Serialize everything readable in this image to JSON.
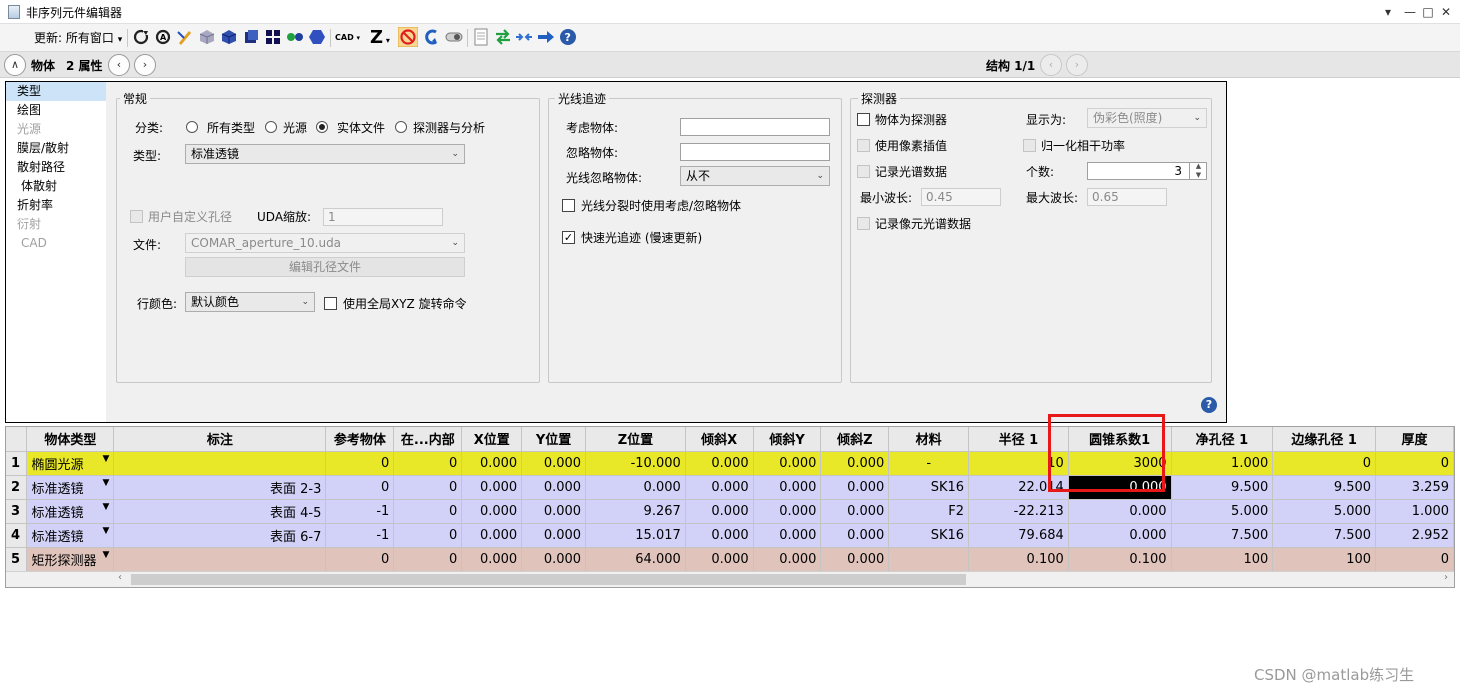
{
  "window": {
    "title": "非序列元件编辑器",
    "controls": [
      "▾",
      "—",
      "□",
      "✕"
    ]
  },
  "toolbar": {
    "update_label": "更新:",
    "update_value": "所有窗口",
    "buttons": [
      "reload-icon",
      "reload-all-icon",
      "pen-icon",
      "cube-gray-icon",
      "cube-blue-icon",
      "cube-navy-icon",
      "grid-icon",
      "dots-icon",
      "hexagon-icon",
      "cad-icon",
      "z-icon",
      "no-icon",
      "undo-icon",
      "toggle-icon",
      "page-icon",
      "swap-icon",
      "collapse-icon",
      "arrow-right-icon",
      "help-icon"
    ],
    "cad_label": "CAD",
    "z_label": "Z"
  },
  "nav": {
    "object_label": "物体",
    "property_label": "2 属性",
    "structure_label": "结构 1/1"
  },
  "sidebar": {
    "items": [
      {
        "label": "类型",
        "selected": true,
        "disabled": false
      },
      {
        "label": "绘图",
        "selected": false,
        "disabled": false
      },
      {
        "label": "光源",
        "selected": false,
        "disabled": true
      },
      {
        "label": "膜层/散射",
        "selected": false,
        "disabled": false
      },
      {
        "label": "散射路径",
        "selected": false,
        "disabled": false
      },
      {
        "label": "体散射",
        "selected": false,
        "disabled": false
      },
      {
        "label": "折射率",
        "selected": false,
        "disabled": false
      },
      {
        "label": "衍射",
        "selected": false,
        "disabled": true
      },
      {
        "label": "CAD",
        "selected": false,
        "disabled": true
      }
    ]
  },
  "general": {
    "title": "常规",
    "category_label": "分类:",
    "radios": [
      "所有类型",
      "光源",
      "实体文件",
      "探测器与分析"
    ],
    "selected_radio": 2,
    "type_label": "类型:",
    "type_value": "标准透镜",
    "user_aperture_label": "用户自定义孔径",
    "uda_scale_label": "UDA缩放:",
    "uda_scale_value": "1",
    "file_label": "文件:",
    "file_value": "COMAR_aperture_10.uda",
    "edit_aperture_button": "编辑孔径文件",
    "row_color_label": "行颜色:",
    "row_color_value": "默认颜色",
    "global_xyz_label": "使用全局XYZ 旋转命令"
  },
  "raytrace": {
    "title": "光线追迹",
    "consider_label": "考虑物体:",
    "consider_value": "",
    "ignore_label": "忽略物体:",
    "ignore_value": "",
    "ray_ignore_label": "光线忽略物体:",
    "ray_ignore_value": "从不",
    "split_label": "光线分裂时使用考虑/忽略物体",
    "fast_label": "快速光追迹 (慢速更新)",
    "fast_checked": true
  },
  "detector": {
    "title": "探测器",
    "is_detector_label": "物体为探测器",
    "display_label": "显示为:",
    "display_value": "伪彩色(照度)",
    "pixel_interp_label": "使用像素插值",
    "normalize_label": "归一化相干功率",
    "record_spectrum_label": "记录光谱数据",
    "count_label": "个数:",
    "count_value": "3",
    "min_wl_label": "最小波长:",
    "min_wl_value": "0.45",
    "max_wl_label": "最大波长:",
    "max_wl_value": "0.65",
    "record_pixel_spectrum_label": "记录像元光谱数据"
  },
  "table": {
    "headers": [
      "",
      "物体类型",
      "标注",
      "参考物体",
      "在...内部",
      "X位置",
      "Y位置",
      "Z位置",
      "倾斜X",
      "倾斜Y",
      "倾斜Z",
      "材料",
      "半径 1",
      "圆锥系数1",
      "净孔径 1",
      "边缘孔径 1",
      "厚度"
    ],
    "rows": [
      {
        "kind": "src",
        "cells": [
          "1",
          "椭圆光源",
          "",
          "0",
          "0",
          "0.000",
          "0.000",
          "-10.000",
          "0.000",
          "0.000",
          "0.000",
          "-",
          "10",
          "3000",
          "1.000",
          "0",
          "0"
        ]
      },
      {
        "kind": "lens",
        "cells": [
          "2",
          "标准透镜",
          "表面 2-3",
          "0",
          "0",
          "0.000",
          "0.000",
          "0.000",
          "0.000",
          "0.000",
          "0.000",
          "SK16",
          "22.014",
          "0.000",
          "9.500",
          "9.500",
          "3.259"
        ]
      },
      {
        "kind": "lens",
        "cells": [
          "3",
          "标准透镜",
          "表面 4-5",
          "-1",
          "0",
          "0.000",
          "0.000",
          "9.267",
          "0.000",
          "0.000",
          "0.000",
          "F2",
          "-22.213",
          "0.000",
          "5.000",
          "5.000",
          "1.000"
        ]
      },
      {
        "kind": "lens",
        "cells": [
          "4",
          "标准透镜",
          "表面 6-7",
          "-1",
          "0",
          "0.000",
          "0.000",
          "15.017",
          "0.000",
          "0.000",
          "0.000",
          "SK16",
          "79.684",
          "0.000",
          "7.500",
          "7.500",
          "2.952"
        ]
      },
      {
        "kind": "det",
        "cells": [
          "5",
          "矩形探测器",
          "",
          "0",
          "0",
          "0.000",
          "0.000",
          "64.000",
          "0.000",
          "0.000",
          "0.000",
          "",
          "0.100",
          "0.100",
          "100",
          "100",
          "0"
        ]
      }
    ]
  },
  "watermark": "CSDN @matlab练习生",
  "colors": {
    "source_row": "#e8e828",
    "lens_row": "#d2d2f8",
    "detector_row": "#e0c4bc",
    "highlight_box": "#e81818"
  }
}
